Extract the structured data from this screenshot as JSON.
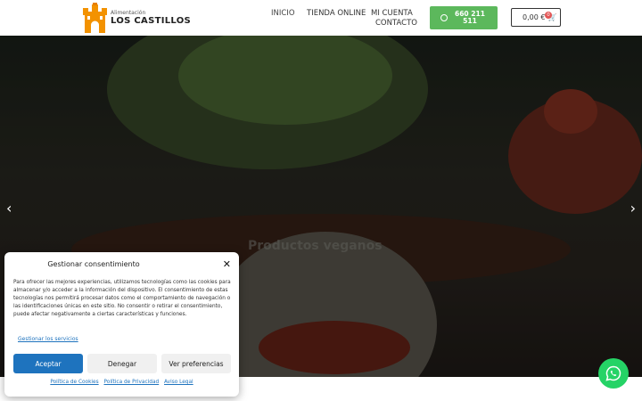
{
  "brand": {
    "subtitle": "Alimentación",
    "name": "LOS CASTILLOS"
  },
  "nav": {
    "items": [
      "INICIO",
      "TIENDA ONLINE",
      "MI CUENTA",
      "CONTACTO"
    ]
  },
  "header": {
    "phone_line1": "660 211",
    "phone_line2": "511",
    "cart_total": "0,00 €",
    "cart_count": "0"
  },
  "hero": {
    "title": "Productos veganos",
    "prev_arrow": "‹",
    "next_arrow": "›"
  },
  "consent": {
    "title": "Gestionar consentimiento",
    "close": "✕",
    "body": "Para ofrecer las mejores experiencias, utilizamos tecnologías como las cookies para almacenar y/o acceder a la información del dispositivo. El consentimiento de estas tecnologías nos permitirá procesar datos como el comportamiento de navegación o las identificaciones únicas en este sitio. No consentir o retirar el consentimiento, puede afectar negativamente a ciertas características y funciones.",
    "manage_link": "Gestionar los servicios",
    "accept": "Aceptar",
    "deny": "Denegar",
    "preferences": "Ver preferencias",
    "footer_links": [
      "Política de Cookies",
      "Política de Privacidad",
      "Aviso Legal"
    ]
  },
  "colors": {
    "accent_blue": "#1e73be",
    "whatsapp_green": "#25d366",
    "phone_button": "#5cb85c",
    "logo_orange": "#f39200"
  }
}
